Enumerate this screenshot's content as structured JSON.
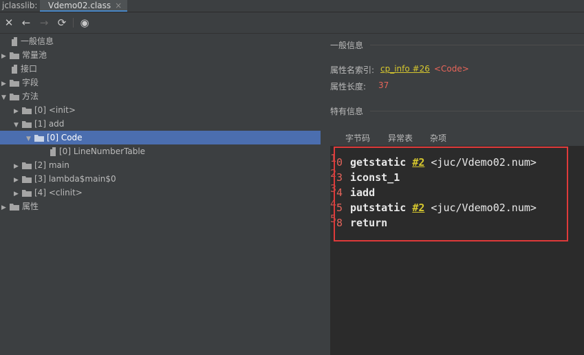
{
  "tabs": {
    "plugin": "jclasslib:",
    "file": "Vdemo02.class",
    "close": "×"
  },
  "toolbar": {
    "close": "✕",
    "back": "←",
    "forward": "→",
    "refresh": "⟳",
    "web": "◉"
  },
  "tree": {
    "general": "一般信息",
    "constant_pool": "常量池",
    "interfaces": "接口",
    "fields": "字段",
    "methods": "方法",
    "m0": "[0] <init>",
    "m1": "[1] add",
    "code": "[0] Code",
    "lnt": "[0] LineNumberTable",
    "m2": "[2] main",
    "m3": "[3] lambda$main$0",
    "m4": "[4] <clinit>",
    "attributes": "属性"
  },
  "info": {
    "section_general": "一般信息",
    "name_index_label": "属性名索引:",
    "name_index_link": "cp_info #26",
    "name_index_value": "<Code>",
    "length_label": "属性长度:",
    "length_value": "37",
    "section_specific": "特有信息"
  },
  "subtabs": [
    "字节码",
    "异常表",
    "杂项"
  ],
  "bytecode": [
    {
      "line": "1",
      "offset": "0",
      "op": "getstatic",
      "ref": "#2",
      "comment": "<juc/Vdemo02.num>"
    },
    {
      "line": "2",
      "offset": "3",
      "op": "iconst_1",
      "ref": "",
      "comment": ""
    },
    {
      "line": "3",
      "offset": "4",
      "op": "iadd",
      "ref": "",
      "comment": ""
    },
    {
      "line": "4",
      "offset": "5",
      "op": "putstatic",
      "ref": "#2",
      "comment": "<juc/Vdemo02.num>"
    },
    {
      "line": "5",
      "offset": "8",
      "op": "return",
      "ref": "",
      "comment": ""
    }
  ],
  "colors": {
    "selection": "#4b6eaf",
    "link": "#d7c82e",
    "highlight_box": "#e03a3a",
    "code_bg": "#2b2b2b"
  }
}
